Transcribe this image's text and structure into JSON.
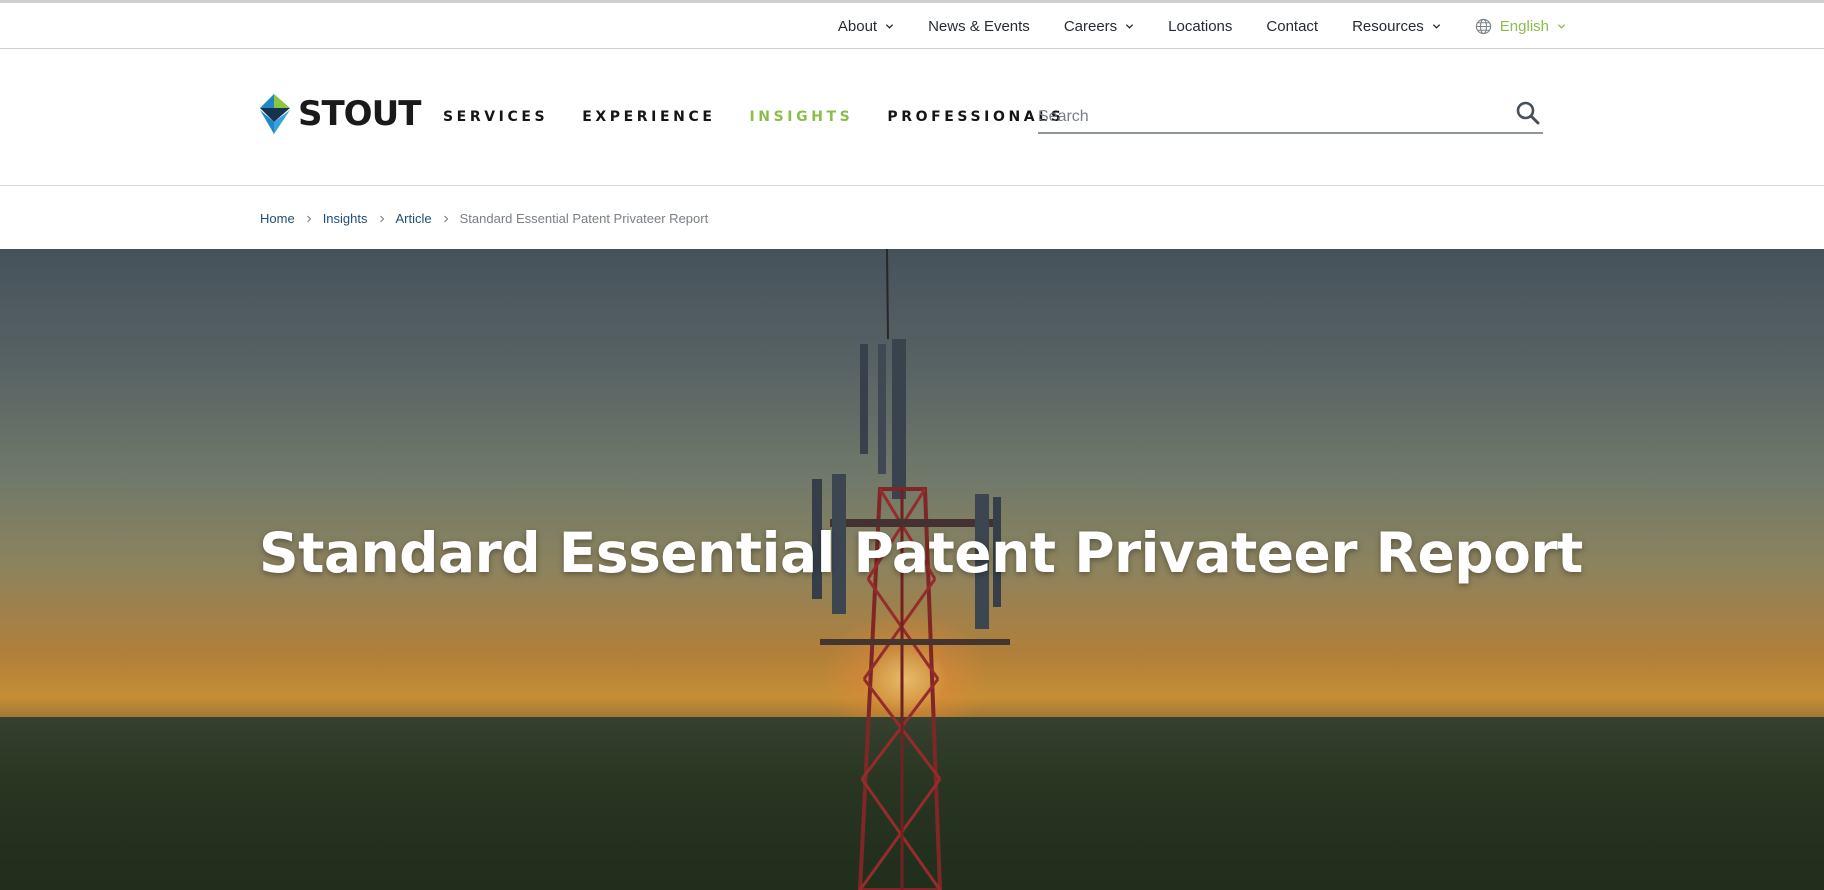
{
  "utility_nav": {
    "items": [
      {
        "label": "About",
        "has_dropdown": true
      },
      {
        "label": "News & Events",
        "has_dropdown": false
      },
      {
        "label": "Careers",
        "has_dropdown": true
      },
      {
        "label": "Locations",
        "has_dropdown": false
      },
      {
        "label": "Contact",
        "has_dropdown": false
      },
      {
        "label": "Resources",
        "has_dropdown": true
      }
    ],
    "language": {
      "label": "English",
      "icon": "globe-icon"
    }
  },
  "header": {
    "logo_text": "STOUT",
    "primary_nav": [
      {
        "label": "SERVICES",
        "active": false
      },
      {
        "label": "EXPERIENCE",
        "active": false
      },
      {
        "label": "INSIGHTS",
        "active": true
      },
      {
        "label": "PROFESSIONALS",
        "active": false
      }
    ],
    "search": {
      "placeholder": "Search",
      "value": "",
      "icon": "search-icon"
    }
  },
  "breadcrumb": {
    "items": [
      "Home",
      "Insights",
      "Article"
    ],
    "current": "Standard Essential Patent Privateer Report"
  },
  "hero": {
    "title": "Standard Essential Patent Privateer Report"
  },
  "colors": {
    "accent_green": "#8cbd4a",
    "link_blue": "#1f4e78",
    "logo_blue": "#1e88c7",
    "logo_green": "#8cc63f",
    "logo_dark": "#16324f"
  }
}
